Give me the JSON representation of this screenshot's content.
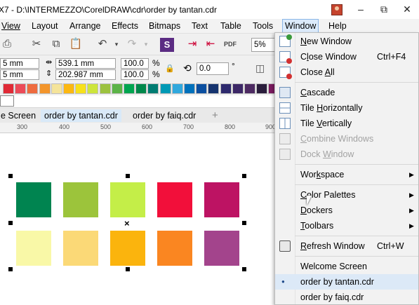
{
  "window": {
    "title": "X7 - D:\\INTERMEZZO\\CorelDRAW\\cdr\\order by tantan.cdr",
    "minimize": "–",
    "restore": "⧉",
    "close": "✕"
  },
  "menubar": [
    "View",
    "Layout",
    "Arrange",
    "Effects",
    "Bitmaps",
    "Text",
    "Table",
    "Tools",
    "Window",
    "Help"
  ],
  "toolbar": {
    "zoom_value": "5%"
  },
  "property_bar": {
    "x_value": "5 mm",
    "y_value": "5 mm",
    "width_value": "539.1 mm",
    "height_value": "202.987 mm",
    "scale_x": "100.0",
    "scale_y": "100.0",
    "percent_label": "%",
    "rotation_value": "0.0",
    "degree_label": "°"
  },
  "palette_colors": [
    "#e02a36",
    "#ec4b59",
    "#ee6b3f",
    "#f3952b",
    "#f5e49a",
    "#fcb812",
    "#f7e11b",
    "#cde53c",
    "#9cc23f",
    "#5cb347",
    "#00a550",
    "#00884b",
    "#007c72",
    "#0099b5",
    "#30a8dd",
    "#0071bb",
    "#0b4fa0",
    "#16346f",
    "#2e2a6e",
    "#3d2867",
    "#4d2a62",
    "#2a1d3c",
    "#7b1a5f",
    "#a0195d"
  ],
  "doc_tabs": [
    "e Screen",
    "order by tantan.cdr",
    "order by faiq.cdr",
    "+"
  ],
  "ruler_numbers": [
    "300",
    "400",
    "500",
    "600",
    "700",
    "800",
    "900"
  ],
  "shapes_row1": [
    "#008450",
    "#9cc43b",
    "#c4ee48",
    "#f20f3a",
    "#bd1363"
  ],
  "shapes_row2": [
    "#f9f8a7",
    "#fbd977",
    "#fbb40d",
    "#fa8621",
    "#a3448c"
  ],
  "window_menu": {
    "new_window": {
      "pre": "",
      "ul": "N",
      "post": "ew Window"
    },
    "close_window": {
      "pre": "C",
      "ul": "l",
      "post": "ose Window",
      "shortcut": "Ctrl+F4"
    },
    "close_all": {
      "pre": "Close ",
      "ul": "A",
      "post": "ll"
    },
    "cascade": {
      "pre": "",
      "ul": "C",
      "post": "ascade"
    },
    "tile_horizontally": {
      "pre": "Tile ",
      "ul": "H",
      "post": "orizontally"
    },
    "tile_vertically": {
      "pre": "Tile ",
      "ul": "V",
      "post": "ertically"
    },
    "combine_windows": {
      "pre": "",
      "ul": "C",
      "post": "ombine Windows"
    },
    "dock_window": {
      "pre": "Dock ",
      "ul": "W",
      "post": "indow"
    },
    "workspace": {
      "pre": "Wor",
      "ul": "k",
      "post": "space"
    },
    "color_palettes": {
      "pre": "",
      "ul": "C",
      "post": "olor Palettes"
    },
    "dockers": {
      "pre": "",
      "ul": "D",
      "post": "ockers"
    },
    "toolbars": {
      "pre": "",
      "ul": "T",
      "post": "oolbars"
    },
    "refresh_window": {
      "pre": "",
      "ul": "R",
      "post": "efresh Window",
      "shortcut": "Ctrl+W"
    },
    "welcome_screen": "Welcome Screen",
    "order_tantan": "order by tantan.cdr",
    "order_faiq": "order by faiq.cdr"
  },
  "icons": {
    "submenu_arrow": "▶",
    "bullet": "●"
  }
}
